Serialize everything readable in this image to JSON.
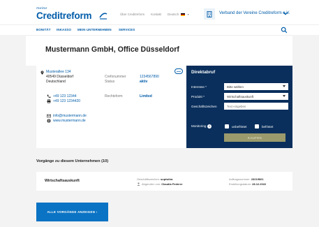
{
  "header": {
    "logo_tagline": "meine",
    "logo_name": "Creditreform",
    "top_links": [
      "Über Creditreform",
      "Kontakt",
      "Deutsch"
    ],
    "verband_label": "Verband der Vereine Creditreform e.V."
  },
  "nav": {
    "items": [
      "BONITÄT",
      "INKASSO",
      "MEIN UNTERNEHMEN",
      "SERVICES"
    ]
  },
  "page_title": "Mustermann GmbH, Office Düsseldorf",
  "company": {
    "street": "Musterallee 134",
    "city": "40549 Düsseldorf",
    "country": "Deutschland",
    "crefo_label": "Crefonummer",
    "crefo_value": "1234567890",
    "status_label": "Status",
    "status_value": "aktiv",
    "rechtsform_label": "Rechtsform",
    "rechtsform_value": "Limited",
    "phone": "+49 123 12344",
    "fax": "+49 123 1234420",
    "email": "info@mustermann.de",
    "web": "www.mustermann.de"
  },
  "direktabruf": {
    "title": "Direktabruf",
    "interesse_label": "Interesse *",
    "interesse_value": "Bitte wählen",
    "produkt_label": "Produkt *",
    "produkt_value": "Wirtschaftsauskunft",
    "geschaeftszeichen_label": "Geschäftszeichen",
    "geschaeftszeichen_placeholder": "Text eingeben",
    "monitoring_label": "Monitoring",
    "unbefristet_label": "unbefristet",
    "befristet_label": "befristet",
    "kaufen_label": "KAUFEN"
  },
  "vorgaenge": {
    "heading": "Vorgänge zu diesem Unternehmen (10)",
    "row": {
      "title": "Wirtschaftsauskunft",
      "gz_label": "Geschäftszeichen:",
      "gz_value": "sup/wiira",
      "by_label": "Abgerufen von:",
      "by_value": "Claudia Federer",
      "nr_label": "Auftragsnummer:",
      "nr_value": "23219661",
      "date_label": "Erstellungsdatum:",
      "date_value": "28.12.2022"
    },
    "all_button": "ALLE VORGÄNGE ANZEIGEN  ›"
  },
  "colors": {
    "brand_blue": "#005ca9",
    "panel_navy": "#0a2f5c",
    "button_blue": "#0a73c4",
    "buy_disabled": "#9a9a6c"
  }
}
